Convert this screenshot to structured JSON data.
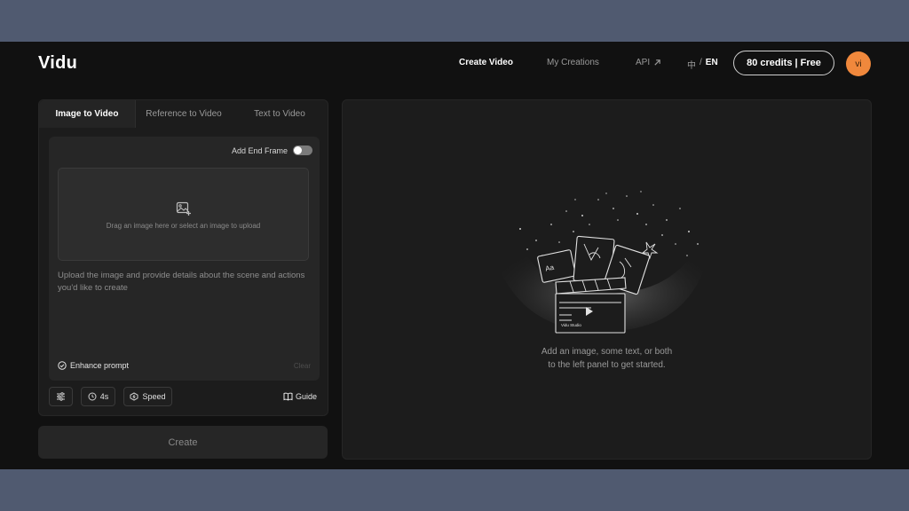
{
  "app": {
    "name": "Vidu"
  },
  "header": {
    "nav": [
      {
        "label": "Create Video",
        "active": true
      },
      {
        "label": "My Creations",
        "active": false
      },
      {
        "label": "API",
        "active": false,
        "icon": "external-arrow-icon"
      }
    ],
    "language": {
      "zh": "中",
      "separator": "/",
      "en": "EN"
    },
    "credits_label": "80 credits | Free",
    "avatar_initials": "vi",
    "avatar_color": "#f0883c"
  },
  "left_panel": {
    "tabs": [
      {
        "label": "Image to Video",
        "active": true
      },
      {
        "label": "Reference to Video",
        "active": false
      },
      {
        "label": "Text to Video",
        "active": false
      }
    ],
    "add_end_frame_label": "Add End Frame",
    "add_end_frame_on": false,
    "dropzone": {
      "icon": "image-plus-icon",
      "text": "Drag an image here or select an image to upload"
    },
    "prompt_placeholder": "Upload the image and provide details about the scene and actions you'd like to create",
    "enhance_prompt_label": "Enhance prompt",
    "clear_label": "Clear",
    "toolbar": {
      "settings_icon": "sliders-icon",
      "duration_label": "4s",
      "speed_label": "Speed",
      "guide_label": "Guide"
    },
    "create_label": "Create"
  },
  "right_panel": {
    "illustration": "vidu-studio-clapperboard-illustration",
    "illustration_text": {
      "card": "Aa",
      "board": "Vidu Studio"
    },
    "empty_line_1": "Add an image, some text, or both",
    "empty_line_2": "to the left panel to get started."
  }
}
